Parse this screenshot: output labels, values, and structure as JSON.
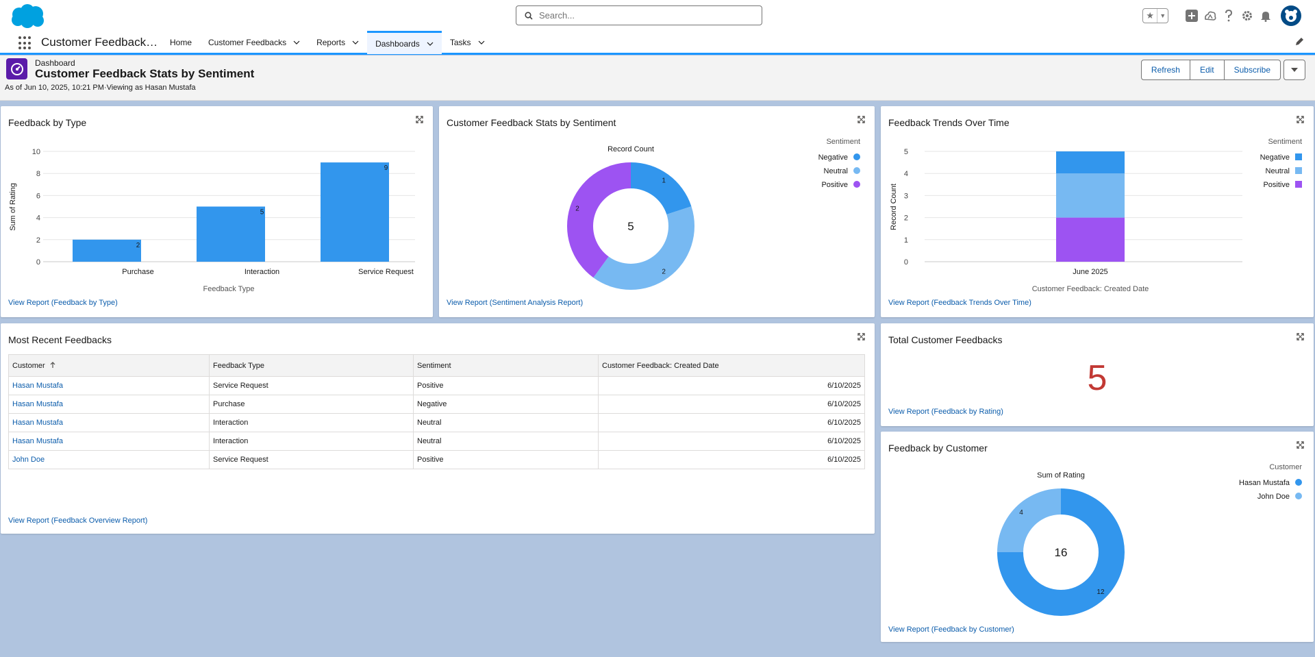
{
  "header": {
    "search_placeholder": "Search...",
    "icons": [
      "favorites-star-icon",
      "caret-down-icon",
      "global-add-icon",
      "trailhead-icon",
      "help-icon",
      "setup-gear-icon",
      "notifications-bell-icon",
      "user-avatar"
    ]
  },
  "nav": {
    "app_name": "Customer Feedback…",
    "items": [
      {
        "label": "Home",
        "has_menu": false
      },
      {
        "label": "Customer Feedbacks",
        "has_menu": true
      },
      {
        "label": "Reports",
        "has_menu": true
      },
      {
        "label": "Dashboards",
        "has_menu": true,
        "active": true
      },
      {
        "label": "Tasks",
        "has_menu": true
      }
    ]
  },
  "dashboard": {
    "eyebrow": "Dashboard",
    "title": "Customer Feedback Stats by Sentiment",
    "meta": "As of Jun 10, 2025, 10:21 PM·Viewing as Hasan Mustafa",
    "buttons": {
      "refresh": "Refresh",
      "edit": "Edit",
      "subscribe": "Subscribe"
    }
  },
  "colors": {
    "bar_blue": "#3296ed",
    "light_blue": "#77b9f2",
    "purple": "#9d53f2",
    "metric_red": "#c23934",
    "link": "#0b5cab"
  },
  "cards": {
    "feedback_by_type": {
      "title": "Feedback by Type",
      "view_report": "View Report (Feedback by Type)"
    },
    "sentiment_stats": {
      "title": "Customer Feedback Stats by Sentiment",
      "view_report": "View Report (Sentiment Analysis Report)"
    },
    "trends": {
      "title": "Feedback Trends Over Time",
      "view_report": "View Report (Feedback Trends Over Time)"
    },
    "recent": {
      "title": "Most Recent Feedbacks",
      "view_report": "View Report (Feedback Overview Report)",
      "columns": [
        "Customer",
        "Feedback Type",
        "Sentiment",
        "Customer Feedback: Created Date"
      ],
      "rows": [
        [
          "Hasan Mustafa",
          "Service Request",
          "Positive",
          "6/10/2025"
        ],
        [
          "Hasan Mustafa",
          "Purchase",
          "Negative",
          "6/10/2025"
        ],
        [
          "Hasan Mustafa",
          "Interaction",
          "Neutral",
          "6/10/2025"
        ],
        [
          "Hasan Mustafa",
          "Interaction",
          "Neutral",
          "6/10/2025"
        ],
        [
          "John Doe",
          "Service Request",
          "Positive",
          "6/10/2025"
        ]
      ]
    },
    "total": {
      "title": "Total Customer Feedbacks",
      "value": "5",
      "view_report": "View Report (Feedback by Rating)"
    },
    "by_customer": {
      "title": "Feedback by Customer",
      "view_report": "View Report (Feedback by Customer)"
    }
  },
  "chart_data": [
    {
      "id": "feedback_by_type",
      "type": "bar",
      "categories": [
        "Purchase",
        "Interaction",
        "Service Request"
      ],
      "values": [
        2,
        5,
        9
      ],
      "ylabel": "Sum of Rating",
      "xlabel": "Feedback Type",
      "ylim": [
        0,
        10
      ],
      "yticks": [
        0,
        2,
        4,
        6,
        8,
        10
      ],
      "grid": true
    },
    {
      "id": "sentiment_stats",
      "type": "pie",
      "donut": true,
      "title": "Record Count",
      "total": "5",
      "legend_title": "Sentiment",
      "legend_position": "top-right",
      "slices": [
        {
          "name": "Negative",
          "value": 1,
          "color": "#3296ed"
        },
        {
          "name": "Neutral",
          "value": 2,
          "color": "#77b9f2"
        },
        {
          "name": "Positive",
          "value": 2,
          "color": "#9d53f2"
        }
      ]
    },
    {
      "id": "trends",
      "type": "bar",
      "stacked": true,
      "categories": [
        "June 2025"
      ],
      "ylabel": "Record Count",
      "xlabel": "Customer Feedback: Created Date",
      "ylim": [
        0,
        5
      ],
      "yticks": [
        0,
        1,
        2,
        3,
        4,
        5
      ],
      "legend_title": "Sentiment",
      "legend_position": "top-right",
      "series": [
        {
          "name": "Positive",
          "values": [
            2
          ],
          "color": "#9d53f2"
        },
        {
          "name": "Neutral",
          "values": [
            2
          ],
          "color": "#77b9f2"
        },
        {
          "name": "Negative",
          "values": [
            1
          ],
          "color": "#3296ed"
        }
      ],
      "legend_order": [
        "Negative",
        "Neutral",
        "Positive"
      ],
      "grid": true
    },
    {
      "id": "by_customer",
      "type": "pie",
      "donut": true,
      "title": "Sum of Rating",
      "total": "16",
      "legend_title": "Customer",
      "legend_position": "top-right",
      "slices": [
        {
          "name": "Hasan Mustafa",
          "value": 12,
          "color": "#3296ed"
        },
        {
          "name": "John Doe",
          "value": 4,
          "color": "#77b9f2"
        }
      ]
    }
  ]
}
